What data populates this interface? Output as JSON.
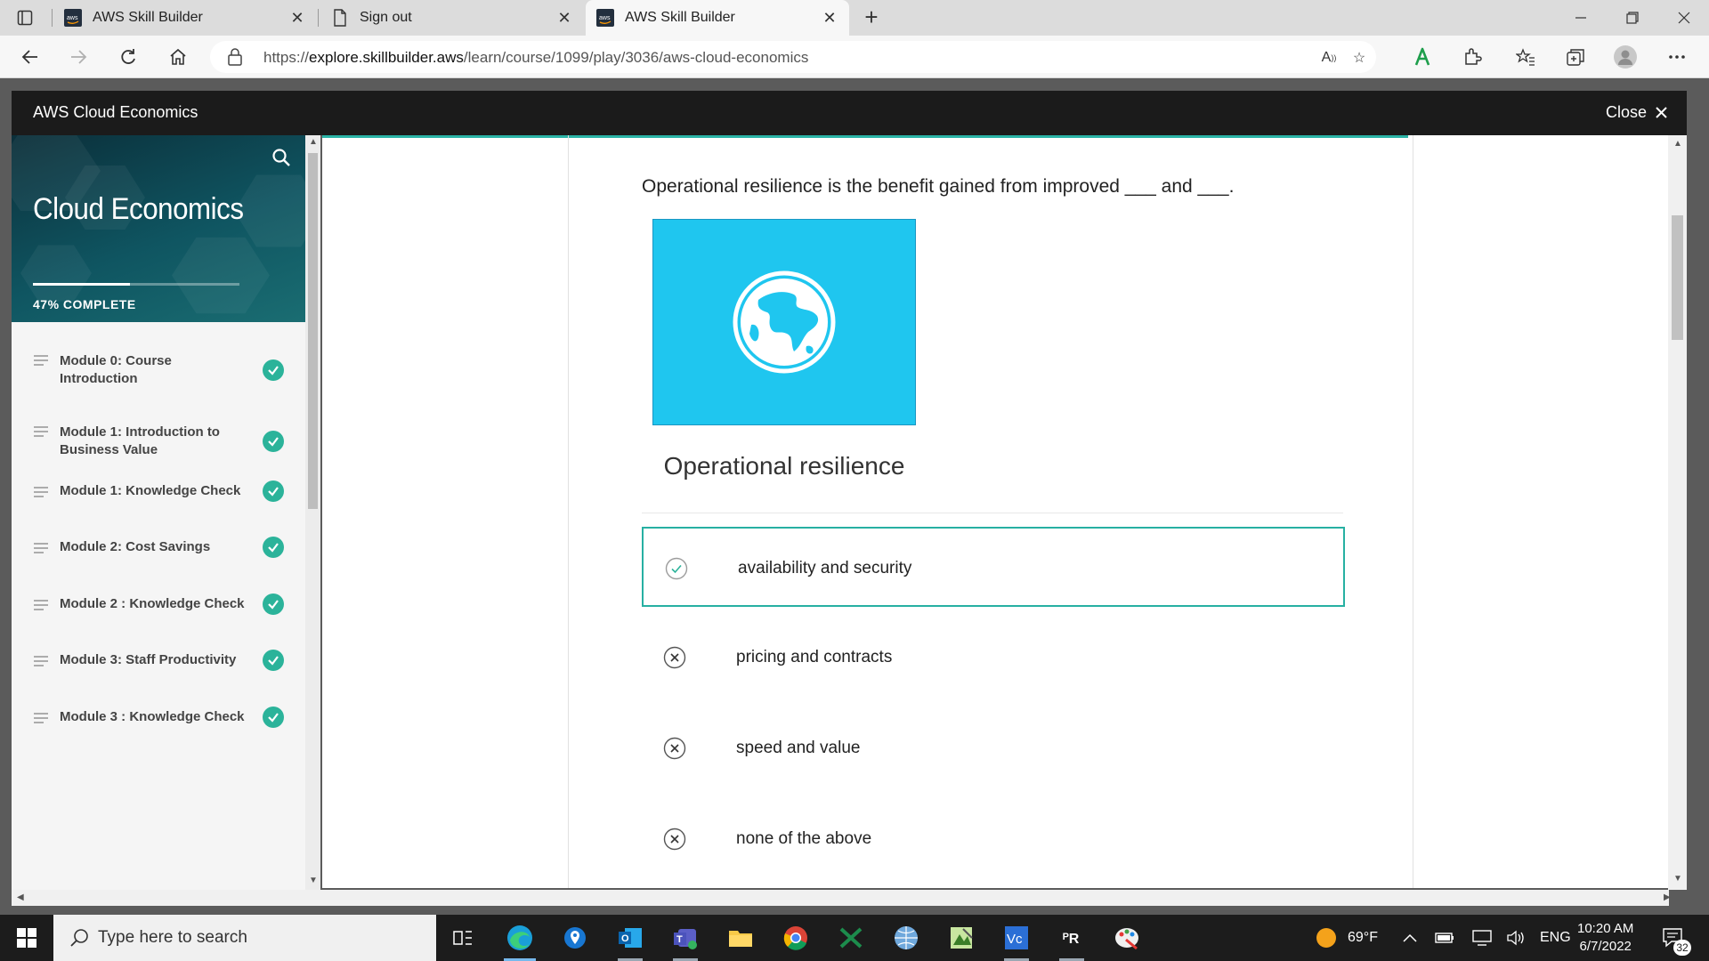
{
  "browser": {
    "tabs": [
      {
        "title": "AWS Skill Builder",
        "favicon": "aws-icon",
        "active": false
      },
      {
        "title": "Sign out",
        "favicon": "page-icon",
        "active": false
      },
      {
        "title": "AWS Skill Builder",
        "favicon": "aws-icon",
        "active": true
      }
    ],
    "url_prefix": "https://",
    "url_host": "explore.skillbuilder.aws",
    "url_path": "/learn/course/1099/play/3036/aws-cloud-economics"
  },
  "course": {
    "title": "AWS Cloud Economics",
    "close_label": "Close"
  },
  "sidebar": {
    "title": "Cloud Economics",
    "progress_text": "47% COMPLETE",
    "progress_fraction": 0.47,
    "modules": [
      {
        "label": "Module 0: Course Introduction",
        "completed": true
      },
      {
        "label": "Module 1: Introduction to Business Value",
        "completed": true
      },
      {
        "label": "Module 1: Knowledge Check",
        "completed": true
      },
      {
        "label": "Module 2: Cost Savings",
        "completed": true
      },
      {
        "label": "Module 2 : Knowledge Check",
        "completed": true
      },
      {
        "label": "Module 3: Staff Productivity",
        "completed": true
      },
      {
        "label": "Module 3 : Knowledge Check",
        "completed": true
      }
    ]
  },
  "quiz": {
    "question": "Operational resilience is the benefit gained from improved ___ and ___.",
    "image_icon": "globe-icon",
    "image_caption": "Operational resilience",
    "answers": [
      {
        "text": "availability and security",
        "state": "correct",
        "selected": true
      },
      {
        "text": "pricing and contracts",
        "state": "incorrect",
        "selected": false
      },
      {
        "text": "speed and value",
        "state": "incorrect",
        "selected": false
      },
      {
        "text": "none of the above",
        "state": "incorrect",
        "selected": false
      }
    ]
  },
  "taskbar": {
    "search_placeholder": "Type here to search",
    "weather": "69°F",
    "language": "ENG",
    "time": "10:20 AM",
    "date": "6/7/2022",
    "notifications": "32"
  },
  "colors": {
    "accent": "#2bb39a",
    "image_bg": "#1fc6ef",
    "course_bar": "#1b1b1b"
  }
}
